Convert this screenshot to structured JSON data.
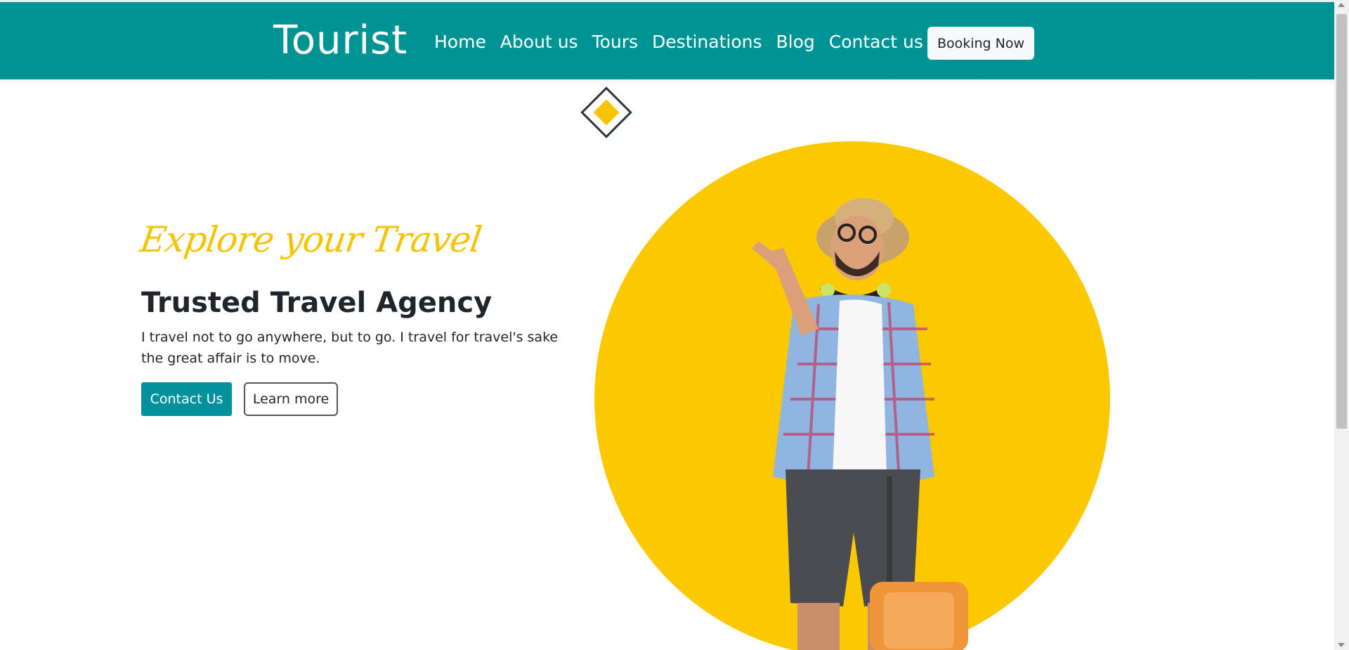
{
  "brand": "Tourist",
  "nav": {
    "items": [
      {
        "label": "Home"
      },
      {
        "label": "About us"
      },
      {
        "label": "Tours"
      },
      {
        "label": "Destinations"
      },
      {
        "label": "Blog"
      },
      {
        "label": "Contact us"
      }
    ],
    "booking_label": "Booking Now"
  },
  "hero": {
    "tagline": "Explore your Travel",
    "headline": "Trusted Travel Agency",
    "lead": "I travel not to go anywhere, but to go. I travel for travel's sake the great affair is to move.",
    "contact_label": "Contact Us",
    "learn_label": "Learn more",
    "image_icon": "tourist-man-with-suitcase"
  },
  "colors": {
    "navbar": "#009394",
    "accent_yellow": "#fcc800",
    "button_teal": "#03919e",
    "text_dark": "#212529"
  }
}
